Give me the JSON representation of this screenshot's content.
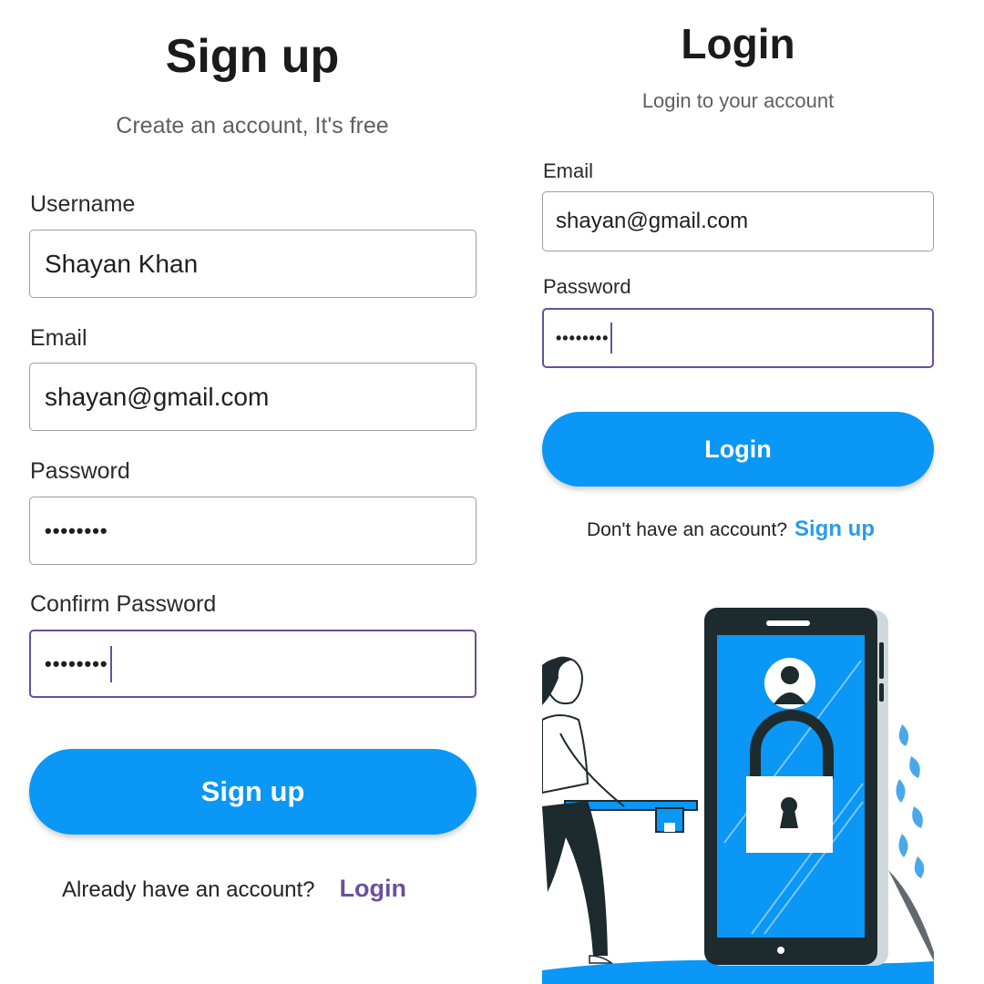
{
  "colors": {
    "accent_blue": "#0a97f5",
    "focus_purple": "#6a4fa0",
    "link_purple": "#6a4fa0",
    "link_blue": "#2a9de8",
    "phone_screen": "#0a97f5",
    "phone_body": "#1d2a2e"
  },
  "signup": {
    "title": "Sign up",
    "subtitle": "Create an account, It's free",
    "username_label": "Username",
    "username_value": "Shayan Khan",
    "email_label": "Email",
    "email_value": "shayan@gmail.com",
    "password_label": "Password",
    "password_value": "••••••••",
    "confirm_label": "Confirm Password",
    "confirm_value": "••••••••",
    "submit_label": "Sign up",
    "footer_text": "Already have an account?",
    "footer_link": "Login"
  },
  "login": {
    "title": "Login",
    "subtitle": "Login to your account",
    "email_label": "Email",
    "email_value": "shayan@gmail.com",
    "password_label": "Password",
    "password_value": "••••••••",
    "submit_label": "Login",
    "footer_text": "Don't have an account?",
    "footer_link": "Sign up"
  },
  "illustration": {
    "icons": [
      "user-avatar-icon",
      "padlock-icon",
      "key-icon",
      "leaf-plant-icon"
    ]
  }
}
